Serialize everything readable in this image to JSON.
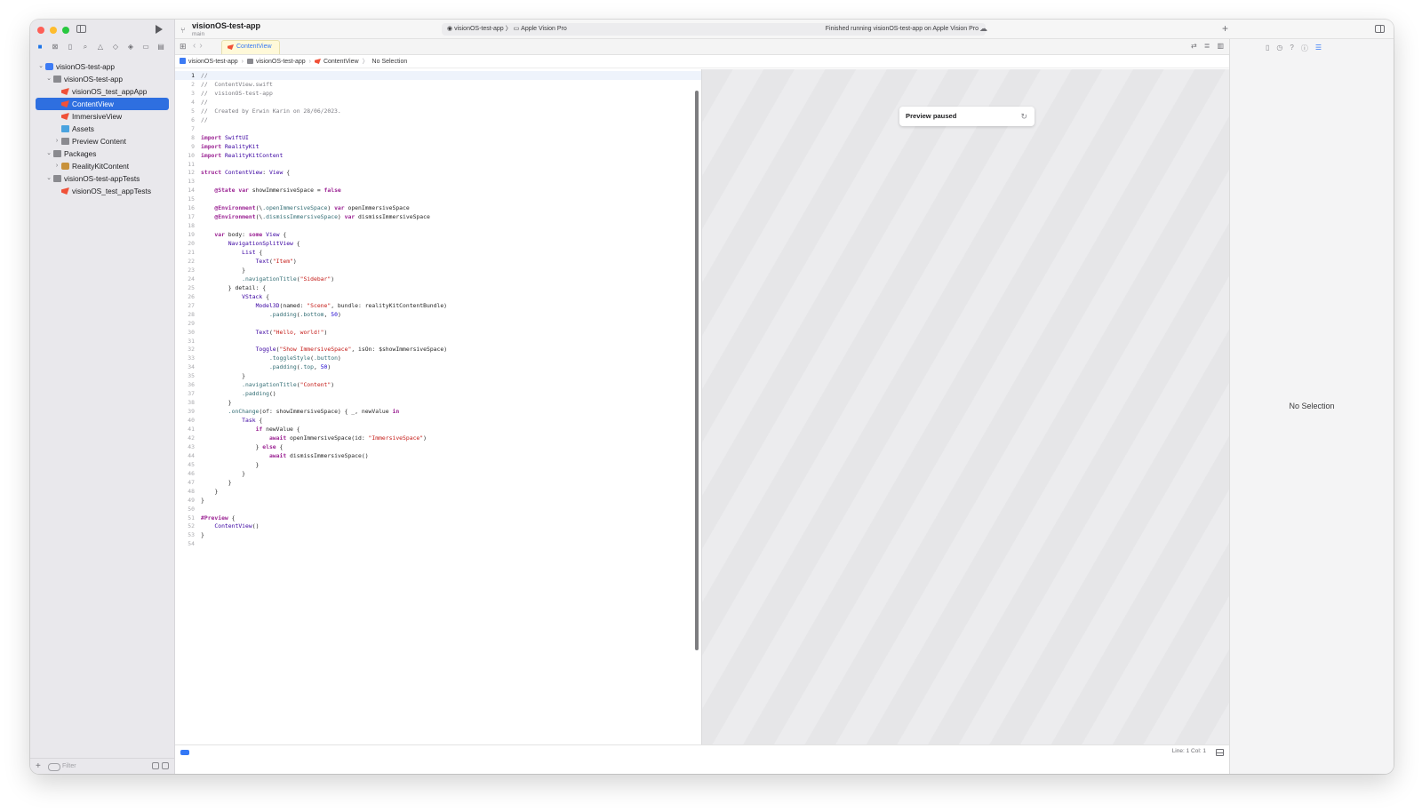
{
  "toolbar": {
    "project_name": "visionOS-test-app",
    "branch": "main",
    "scheme": "visionOS-test-app",
    "device": "Apple Vision Pro",
    "status": "Finished running visionOS-test-app on Apple Vision Pro"
  },
  "sidebar": {
    "filter_placeholder": "Filter",
    "items": [
      {
        "label": "visionOS-test-app",
        "icon": "project-icon",
        "depth": 0,
        "chevron": "v",
        "selected": false
      },
      {
        "label": "visionOS-test-app",
        "icon": "folder-icon",
        "depth": 1,
        "chevron": "v",
        "selected": false
      },
      {
        "label": "visionOS_test_appApp",
        "icon": "swift-file-icon",
        "depth": 2,
        "chevron": "",
        "selected": false
      },
      {
        "label": "ContentView",
        "icon": "swift-file-icon",
        "depth": 2,
        "chevron": "",
        "selected": true
      },
      {
        "label": "ImmersiveView",
        "icon": "swift-file-icon",
        "depth": 2,
        "chevron": "",
        "selected": false
      },
      {
        "label": "Assets",
        "icon": "assets-icon",
        "depth": 2,
        "chevron": "",
        "selected": false
      },
      {
        "label": "Preview Content",
        "icon": "folder-icon",
        "depth": 2,
        "chevron": ">",
        "selected": false
      },
      {
        "label": "Packages",
        "icon": "folder-icon",
        "depth": 1,
        "chevron": "v",
        "selected": false
      },
      {
        "label": "RealityKitContent",
        "icon": "package-icon",
        "depth": 2,
        "chevron": ">",
        "selected": false
      },
      {
        "label": "visionOS-test-appTests",
        "icon": "folder-icon",
        "depth": 1,
        "chevron": "v",
        "selected": false
      },
      {
        "label": "visionOS_test_appTests",
        "icon": "swift-file-icon",
        "depth": 2,
        "chevron": "",
        "selected": false
      }
    ]
  },
  "tab": {
    "label": "ContentView"
  },
  "breadcrumb": [
    "visionOS-test-app",
    "visionOS-test-app",
    "ContentView",
    "No Selection"
  ],
  "editor": {
    "current_line": 1,
    "lines": [
      "//",
      "//  ContentView.swift",
      "//  visionOS-test-app",
      "//",
      "//  Created by Erwin Karin on 28/06/2023.",
      "//",
      "",
      "import SwiftUI",
      "import RealityKit",
      "import RealityKitContent",
      "",
      "struct ContentView: View {",
      "",
      "    @State var showImmersiveSpace = false",
      "",
      "    @Environment(\\.openImmersiveSpace) var openImmersiveSpace",
      "    @Environment(\\.dismissImmersiveSpace) var dismissImmersiveSpace",
      "",
      "    var body: some View {",
      "        NavigationSplitView {",
      "            List {",
      "                Text(\"Item\")",
      "            }",
      "            .navigationTitle(\"Sidebar\")",
      "        } detail: {",
      "            VStack {",
      "                Model3D(named: \"Scene\", bundle: realityKitContentBundle)",
      "                    .padding(.bottom, 50)",
      "",
      "                Text(\"Hello, world!\")",
      "",
      "                Toggle(\"Show ImmersiveSpace\", isOn: $showImmersiveSpace)",
      "                    .toggleStyle(.button)",
      "                    .padding(.top, 50)",
      "            }",
      "            .navigationTitle(\"Content\")",
      "            .padding()",
      "        }",
      "        .onChange(of: showImmersiveSpace) { _, newValue in",
      "            Task {",
      "                if newValue {",
      "                    await openImmersiveSpace(id: \"ImmersiveSpace\")",
      "                } else {",
      "                    await dismissImmersiveSpace()",
      "                }",
      "            }",
      "        }",
      "    }",
      "}",
      "",
      "#Preview {",
      "    ContentView()",
      "}",
      ""
    ]
  },
  "preview": {
    "status": "Preview paused"
  },
  "inspector": {
    "empty_label": "No Selection"
  },
  "statusbar": {
    "position": "Line: 1  Col: 1"
  },
  "colors": {
    "accent": "#2e6fe0",
    "keyword": "#9b2393",
    "string": "#c41a16",
    "comment": "#7b7b82"
  }
}
